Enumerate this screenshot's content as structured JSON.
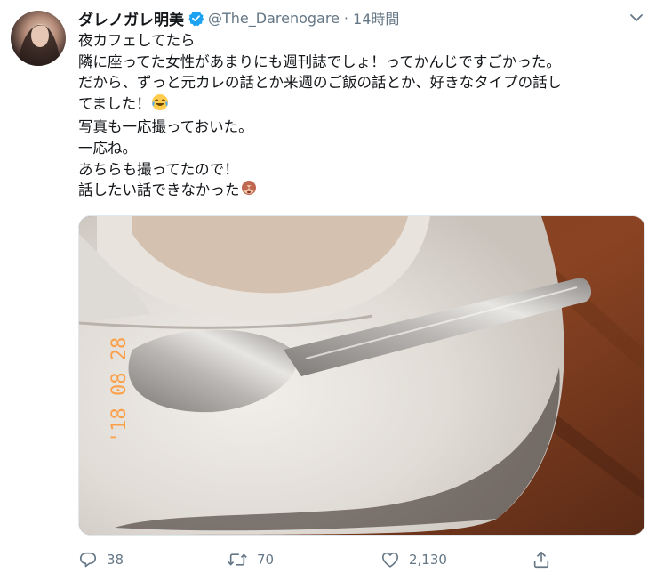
{
  "user": {
    "display_name": "ダレノガレ明美",
    "handle": "@The_Darenogare",
    "separator": "·",
    "time": "14時間"
  },
  "tweet": {
    "lines": [
      "夜カフェしてたら",
      "隣に座ってた女性があまりにも週刊誌でしょ！ってかんじですごかった。",
      "だから、ずっと元カレの話とか来週のご飯の話とか、好きなタイプの話し",
      "てました！",
      "写真も一応撮っておいた。",
      "一応ね。",
      "あちらも撮ってたので！",
      "話したい話できなかった"
    ]
  },
  "photo": {
    "date_stamp": "'18 08 28"
  },
  "actions": {
    "reply_count": "38",
    "retweet_count": "70",
    "like_count": "2,130"
  },
  "colors": {
    "verified": "#1da1f2",
    "muted": "#657786"
  }
}
